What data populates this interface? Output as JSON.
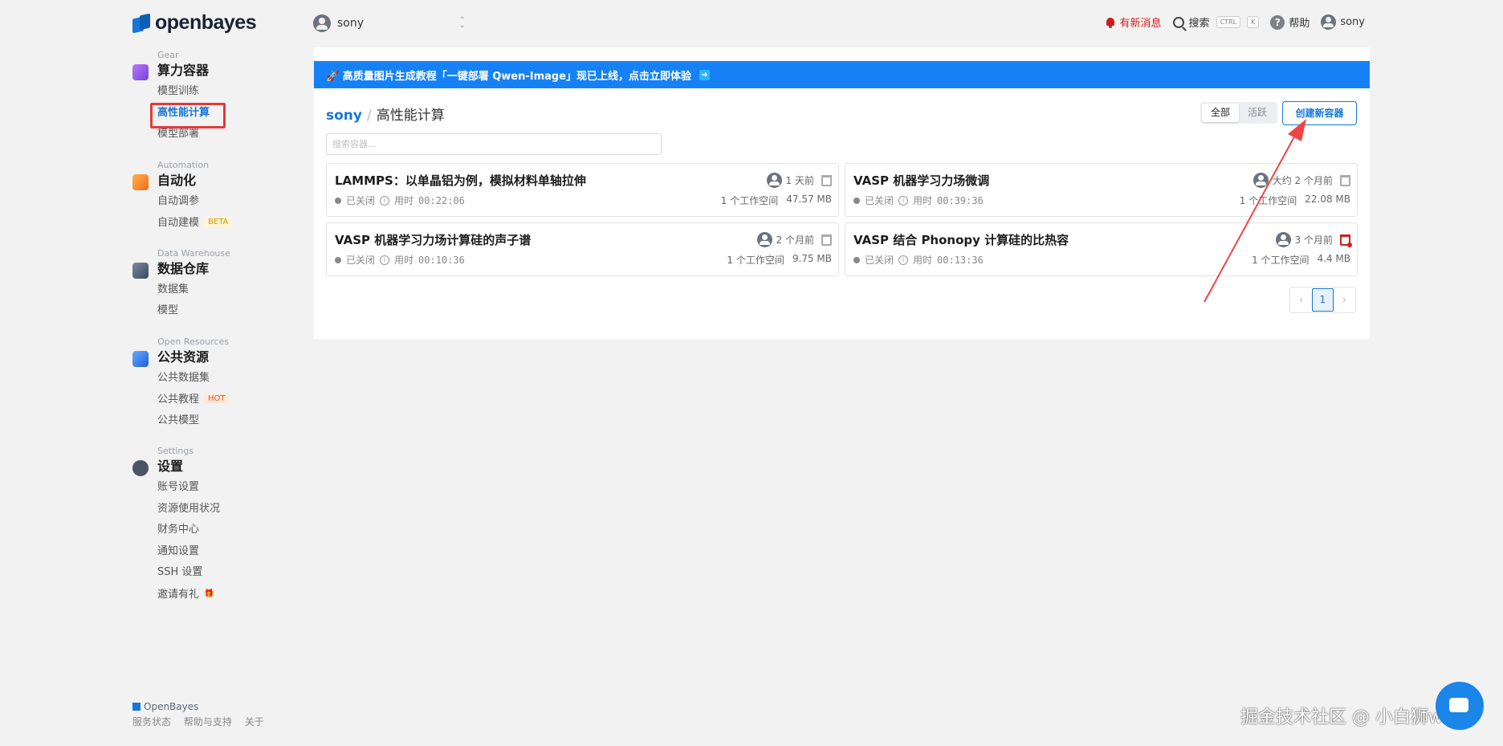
{
  "brand": {
    "name": "openbayes"
  },
  "user_switch": {
    "name": "sony"
  },
  "topbar": {
    "notice": "有新消息",
    "search": "搜索",
    "kbd_ctrl": "CTRL",
    "kbd_k": "K",
    "help": "帮助",
    "user": "sony"
  },
  "sidebar": {
    "groups": [
      {
        "eyebrow": "Gear",
        "title": "算力容器",
        "items": [
          {
            "label": "模型训练"
          },
          {
            "label": "高性能计算"
          },
          {
            "label": "模型部署"
          }
        ]
      },
      {
        "eyebrow": "Automation",
        "title": "自动化",
        "items": [
          {
            "label": "自动调参"
          },
          {
            "label": "自动建模",
            "tag": "BETA"
          }
        ]
      },
      {
        "eyebrow": "Data Warehouse",
        "title": "数据仓库",
        "items": [
          {
            "label": "数据集"
          },
          {
            "label": "模型"
          }
        ]
      },
      {
        "eyebrow": "Open Resources",
        "title": "公共资源",
        "items": [
          {
            "label": "公共数据集"
          },
          {
            "label": "公共教程",
            "tag": "HOT"
          },
          {
            "label": "公共模型"
          }
        ]
      },
      {
        "eyebrow": "Settings",
        "title": "设置",
        "items": [
          {
            "label": "账号设置"
          },
          {
            "label": "资源使用状况"
          },
          {
            "label": "财务中心"
          },
          {
            "label": "通知设置"
          },
          {
            "label": "SSH 设置"
          },
          {
            "label": "邀请有礼"
          }
        ]
      }
    ]
  },
  "footer": {
    "brand": "OpenBayes",
    "links": [
      "服务状态",
      "帮助与支持",
      "关于"
    ]
  },
  "banner": {
    "text": "🚀 高质量图片生成教程「一键部署 Qwen-Image」现已上线，点击立即体验",
    "arrow": "➜"
  },
  "breadcrumb": {
    "user": "sony",
    "separator": "/",
    "page": "高性能计算"
  },
  "filter": {
    "all": "全部",
    "active": "活跃"
  },
  "create_button": "创建新容器",
  "search": {
    "placeholder": "搜索容器..."
  },
  "containers": [
    {
      "title": "LAMMPS：以单晶铝为例，模拟材料单轴拉伸",
      "time": "1 天前",
      "status": "已关闭",
      "duration_label": "用时",
      "duration": "00:22:06",
      "workspaces": "1 个工作空间",
      "size": "47.57 MB"
    },
    {
      "title": "VASP 机器学习力场微调",
      "time": "大约 2 个月前",
      "status": "已关闭",
      "duration_label": "用时",
      "duration": "00:39:36",
      "workspaces": "1 个工作空间",
      "size": "22.08 MB"
    },
    {
      "title": "VASP 机器学习力场计算硅的声子谱",
      "time": "2 个月前",
      "status": "已关闭",
      "duration_label": "用时",
      "duration": "00:10:36",
      "workspaces": "1 个工作空间",
      "size": "9.75 MB"
    },
    {
      "title": "VASP 结合 Phonopy 计算硅的比热容",
      "time": "3 个月前",
      "status": "已关闭",
      "duration_label": "用时",
      "duration": "00:13:36",
      "workspaces": "1 个工作空间",
      "size": "4.4 MB"
    }
  ],
  "pagination": {
    "prev": "‹",
    "current": "1",
    "next": "›"
  },
  "watermark": "掘金技术社区 @ 小白狮ww",
  "colors": {
    "accent": "#1677d8",
    "banner": "#1681f5",
    "alert": "#d11c1c",
    "annotation": "#e23a3a"
  },
  "icons": [
    "cube-icon",
    "automation-icon",
    "database-icon",
    "resources-icon",
    "settings-icon",
    "bell-icon",
    "search-icon",
    "help-icon",
    "avatar-icon",
    "trash-icon",
    "info-icon"
  ]
}
